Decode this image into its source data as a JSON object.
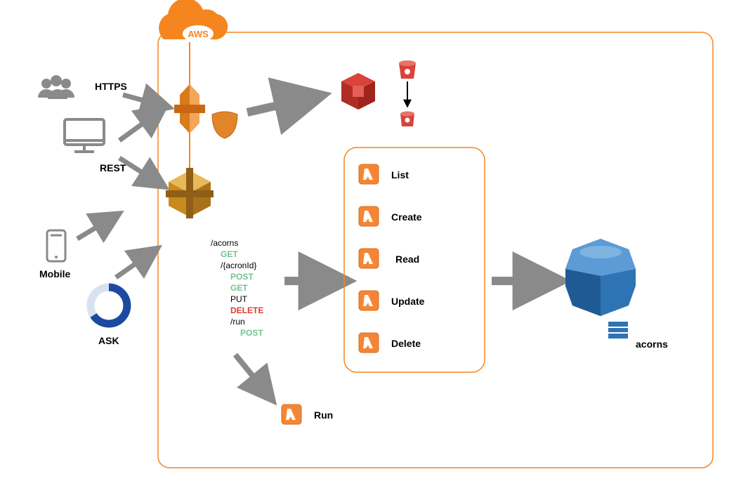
{
  "cloud_label": "AWS",
  "clients": {
    "https": "HTTPS",
    "rest": "REST",
    "mobile": "Mobile",
    "ask": "ASK"
  },
  "api_spec": [
    {
      "text": "/acorns",
      "cls": "api-path",
      "indent": 0
    },
    {
      "text": "GET",
      "cls": "api-get",
      "indent": 1
    },
    {
      "text": "/{acronId}",
      "cls": "api-path",
      "indent": 1
    },
    {
      "text": "POST",
      "cls": "api-post",
      "indent": 2
    },
    {
      "text": "GET",
      "cls": "api-get",
      "indent": 2
    },
    {
      "text": "PUT",
      "cls": "api-put",
      "indent": 2
    },
    {
      "text": "DELETE",
      "cls": "api-delete",
      "indent": 2
    },
    {
      "text": "/run",
      "cls": "api-path",
      "indent": 2
    },
    {
      "text": "POST",
      "cls": "api-post",
      "indent": 3
    }
  ],
  "lambdas": {
    "list": "List",
    "create": "Create",
    "read": "Read",
    "update": "Update",
    "delete": "Delete",
    "run": "Run"
  },
  "db_label": "acorns"
}
